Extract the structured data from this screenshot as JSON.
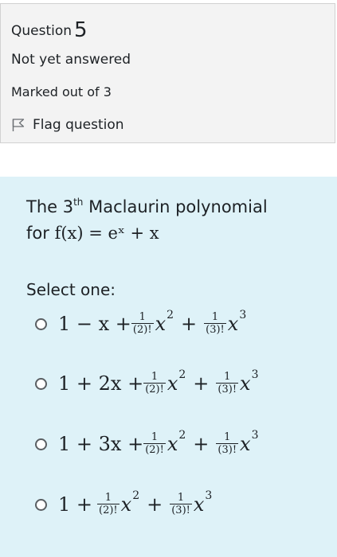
{
  "info": {
    "question_label": "Question",
    "question_number": "5",
    "state": "Not yet answered",
    "grade": "Marked out of 3",
    "flag_label": "Flag question",
    "flag_icon": "flag-icon"
  },
  "question": {
    "text_before": "The 3",
    "text_sup": "th",
    "text_after": " Maclaurin polynomial",
    "line2_prefix": "for ",
    "function_math": "f(x) = eˣ + x",
    "prompt": "Select one:"
  },
  "options": [
    {
      "lead": "1 − x +",
      "frac1_num": "1",
      "frac1_den": "(2)!",
      "term1": "x",
      "exp1": "2",
      "mid": "+",
      "frac2_num": "1",
      "frac2_den": "(3)!",
      "term2": "x",
      "exp2": "3"
    },
    {
      "lead": "1 + 2x +",
      "frac1_num": "1",
      "frac1_den": "(2)!",
      "term1": "x",
      "exp1": "2",
      "mid": "+",
      "frac2_num": "1",
      "frac2_den": "(3)!",
      "term2": "x",
      "exp2": "3"
    },
    {
      "lead": "1 + 3x +",
      "frac1_num": "1",
      "frac1_den": "(2)!",
      "term1": "x",
      "exp1": "2",
      "mid": "+",
      "frac2_num": "1",
      "frac2_den": "(3)!",
      "term2": "x",
      "exp2": "3"
    },
    {
      "lead": "1 +",
      "frac1_num": "1",
      "frac1_den": "(2)!",
      "term1": "x",
      "exp1": "2",
      "mid": "+",
      "frac2_num": "1",
      "frac2_den": "(3)!",
      "term2": "x",
      "exp2": "3"
    }
  ]
}
